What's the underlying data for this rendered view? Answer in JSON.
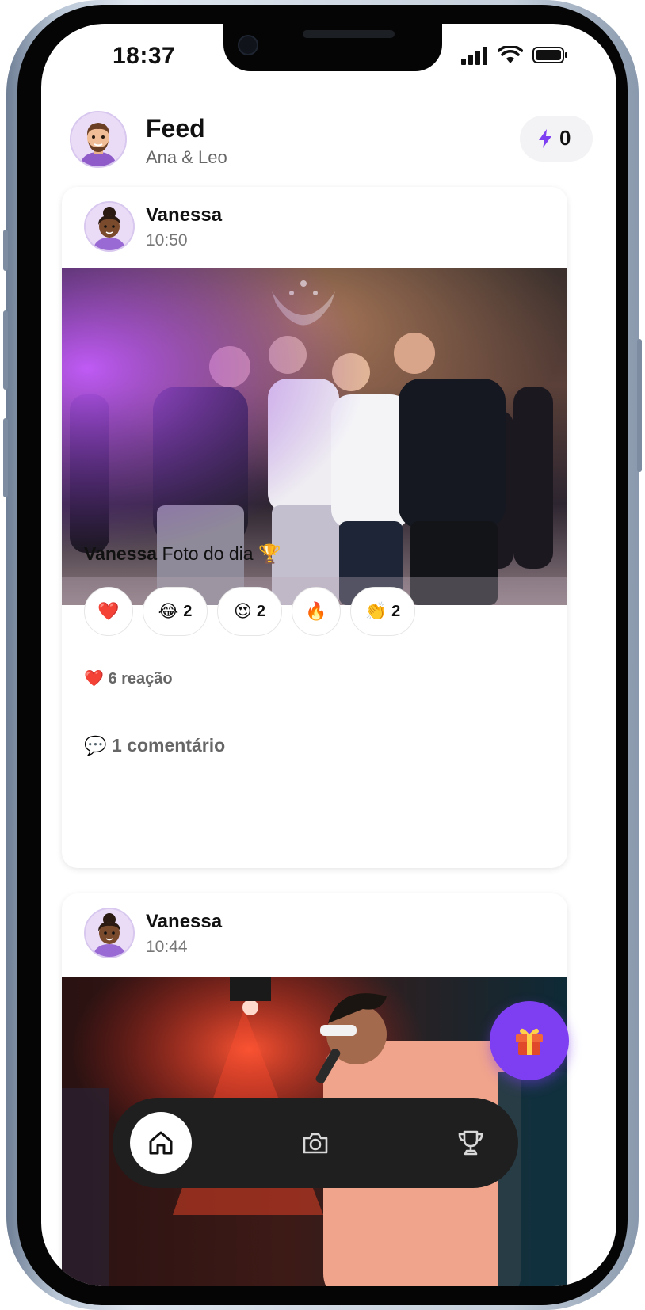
{
  "status_bar": {
    "time": "18:37"
  },
  "header": {
    "title": "Feed",
    "subtitle": "Ana & Leo",
    "points_icon": "lightning-icon",
    "points_value": "0"
  },
  "posts": [
    {
      "author": "Vanessa",
      "time": "10:50",
      "caption_author": "Vanessa",
      "caption_text": "Foto do dia 🏆",
      "reactions": [
        {
          "emoji": "❤️",
          "count": ""
        },
        {
          "emoji": "😂",
          "count": "2"
        },
        {
          "emoji": "😍",
          "count": "2"
        },
        {
          "emoji": "🔥",
          "count": ""
        },
        {
          "emoji": "👏",
          "count": "2"
        }
      ],
      "reaction_summary": "❤️ 6 reação",
      "comments": "💬 1 comentário"
    },
    {
      "author": "Vanessa",
      "time": "10:44"
    }
  ],
  "fab": {
    "icon": "gift-icon"
  },
  "tab_bar": {
    "tabs": [
      {
        "icon": "home-icon",
        "active": true
      },
      {
        "icon": "camera-icon",
        "active": false
      },
      {
        "icon": "trophy-icon",
        "active": false
      }
    ]
  },
  "colors": {
    "accent": "#7e3ff2",
    "tab_bar_bg": "#1f1f1f"
  }
}
